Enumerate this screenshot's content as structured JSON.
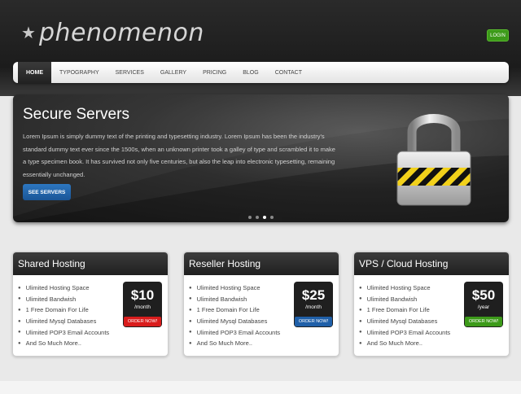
{
  "header": {
    "logo_text": "phenomenon",
    "login_label": "LOGIN"
  },
  "nav": {
    "items": [
      {
        "label": "HOME"
      },
      {
        "label": "TYPOGRAPHY"
      },
      {
        "label": "SERVICES"
      },
      {
        "label": "GALLERY"
      },
      {
        "label": "PRICING"
      },
      {
        "label": "BLOG"
      },
      {
        "label": "CONTACT"
      }
    ],
    "active": "HOME"
  },
  "hero": {
    "title": "Secure Servers",
    "text": "Lorem Ipsum is simply dummy text of the printing and typesetting industry. Lorem Ipsum has been the industry's standard dummy text ever since the 1500s, when an unknown printer took a galley of type and scrambled it to make a type specimen book. It has survived not only five centuries, but also the leap into electronic typesetting, remaining essentially unchanged.",
    "button_label": "SEE SERVERS",
    "slides": 4,
    "active_slide": 3
  },
  "plans": [
    {
      "title": "Shared Hosting",
      "features": [
        "Ulimited Hosting Space",
        "Ulimited Bandwish",
        "1 Free Domain For Life",
        "Ulimited Mysql Databases",
        "Ulimited POP3 Email Accounts",
        "And So Much More.."
      ],
      "price": "$10",
      "period": "/month",
      "order_label": "ORDER NOW!",
      "order_color": "#d91c1c"
    },
    {
      "title": "Reseller Hosting",
      "features": [
        "Ulimited Hosting Space",
        "Ulimited Bandwish",
        "1 Free Domain For Life",
        "Ulimited Mysql Databases",
        "Ulimited POP3 Email Accounts",
        "And So Much More.."
      ],
      "price": "$25",
      "period": "/month",
      "order_label": "ORDER NOW!",
      "order_color": "#1f5fa8"
    },
    {
      "title": "VPS / Cloud Hosting",
      "features": [
        "Ulimited Hosting Space",
        "Ulimited Bandwish",
        "1 Free Domain For Life",
        "Ulimited Mysql Databases",
        "Ulimited POP3 Email Accounts",
        "And So Much More.."
      ],
      "price": "$50",
      "period": "/year",
      "order_label": "ORDER NOW!",
      "order_color": "#3c9a19"
    }
  ],
  "icons": {
    "logo": "star-icon",
    "hero_image": "padlock-icon"
  }
}
